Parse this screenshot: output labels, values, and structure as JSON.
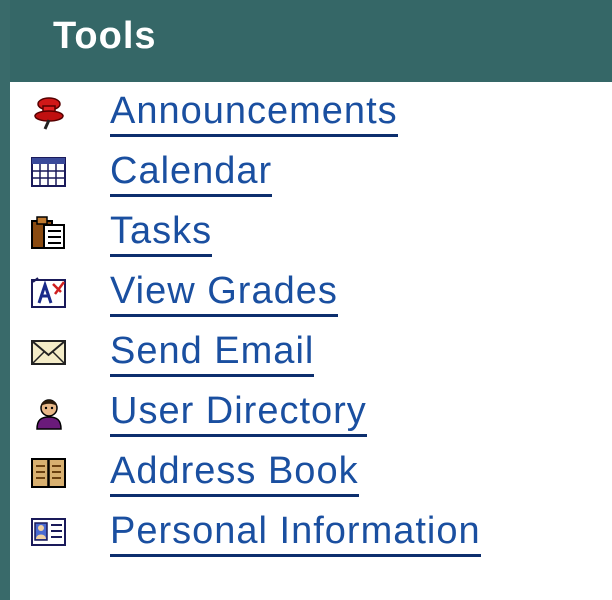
{
  "panel": {
    "title": "Tools",
    "items": [
      {
        "label": "Announcements",
        "icon": "pushpin-icon"
      },
      {
        "label": "Calendar",
        "icon": "calendar-icon"
      },
      {
        "label": "Tasks",
        "icon": "clipboard-icon"
      },
      {
        "label": "View Grades",
        "icon": "grade-report-icon"
      },
      {
        "label": "Send Email",
        "icon": "envelope-icon"
      },
      {
        "label": "User Directory",
        "icon": "user-icon"
      },
      {
        "label": "Address Book",
        "icon": "address-book-icon"
      },
      {
        "label": "Personal Information",
        "icon": "id-card-icon"
      }
    ]
  },
  "colors": {
    "header_bg": "#356767",
    "link": "#1a4fa0"
  }
}
